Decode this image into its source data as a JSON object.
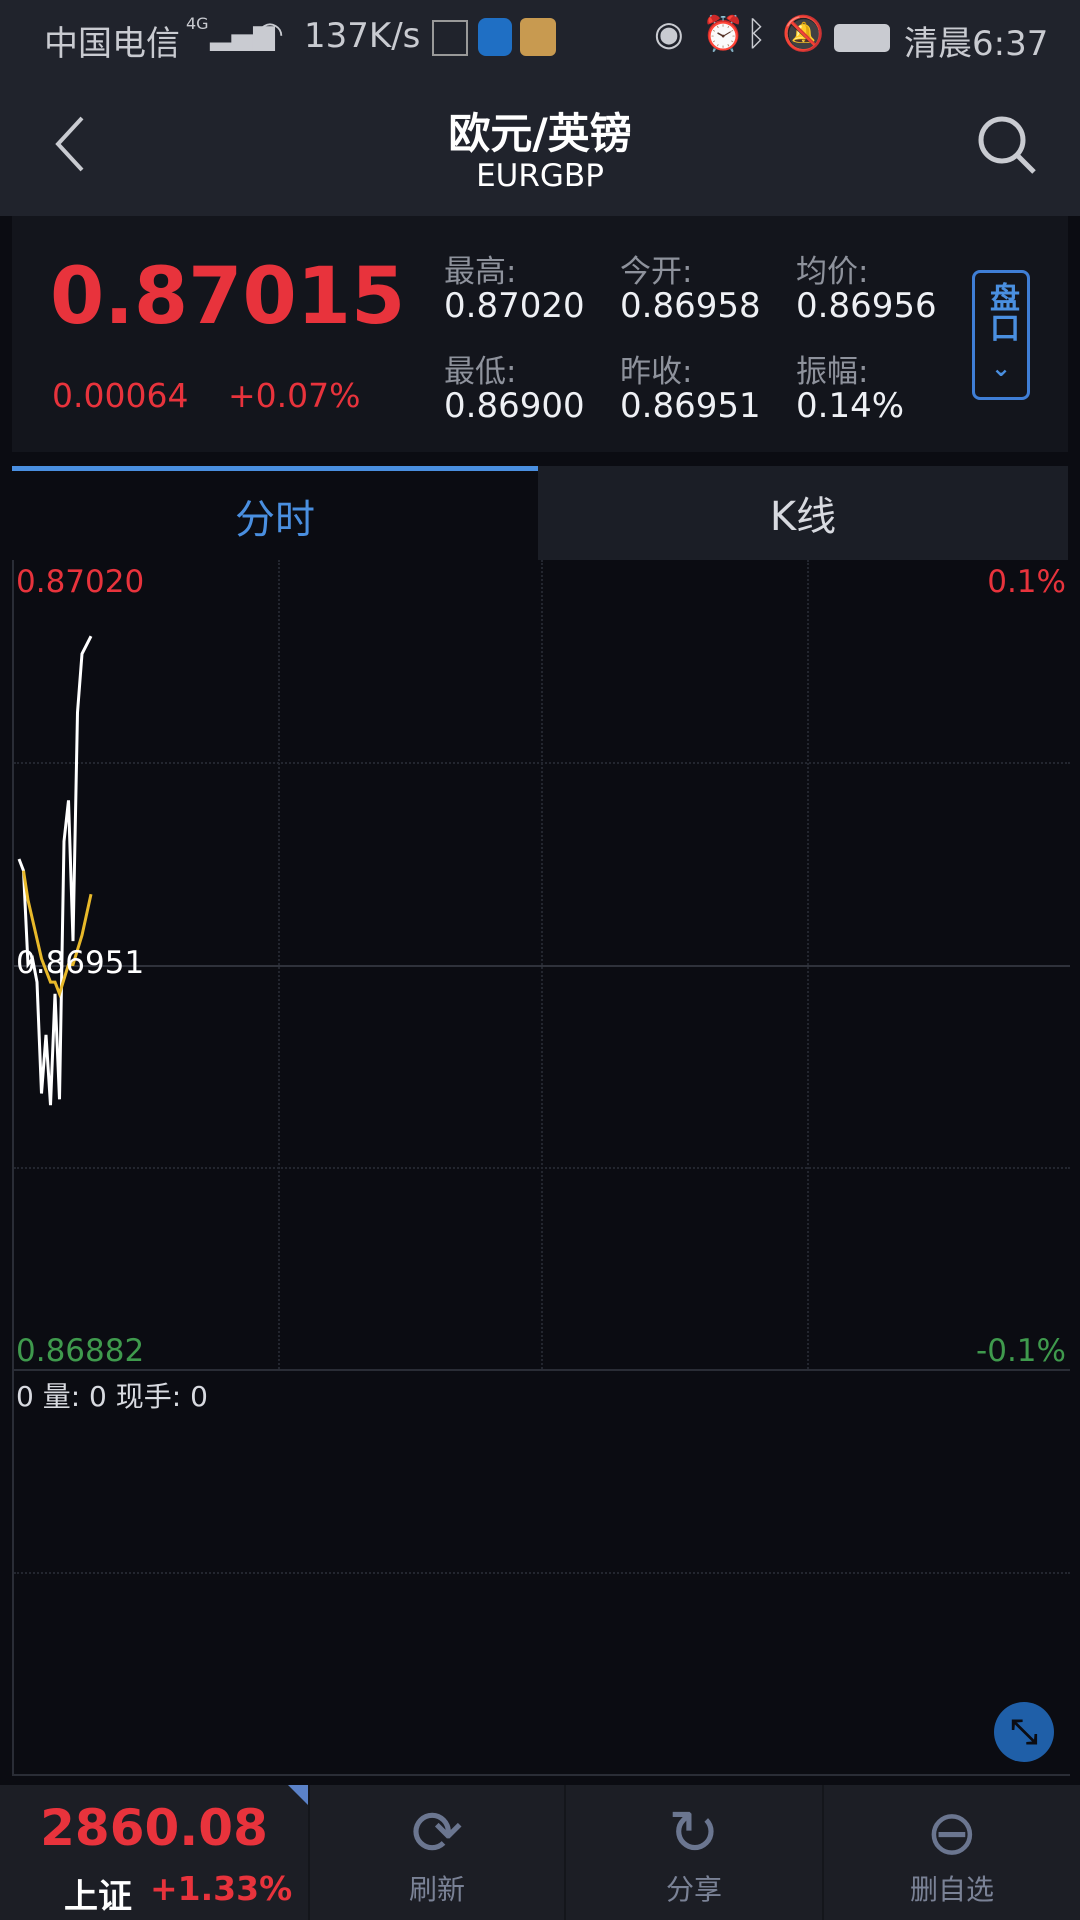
{
  "status_bar": {
    "carrier": "中国电信",
    "network": "4G",
    "speed": "137K/s",
    "time": "清晨6:37",
    "icons": [
      "signal-icon",
      "wifi-icon",
      "news-app-icon",
      "shield-app-icon",
      "app-icon",
      "eye-icon",
      "alarm-icon",
      "bluetooth-icon",
      "mute-icon",
      "battery-icon"
    ]
  },
  "header": {
    "title": "欧元/英镑",
    "subtitle": "EURGBP"
  },
  "quote": {
    "price": "0.87015",
    "change": "0.00064",
    "change_pct": "+0.07%",
    "stats": [
      {
        "label": "最高:",
        "value": "0.87020"
      },
      {
        "label": "今开:",
        "value": "0.86958"
      },
      {
        "label": "均价:",
        "value": "0.86956"
      },
      {
        "label": "最低:",
        "value": "0.86900"
      },
      {
        "label": "昨收:",
        "value": "0.86951"
      },
      {
        "label": "振幅:",
        "value": "0.14%"
      }
    ],
    "panel_button": "盘口"
  },
  "tabs": [
    {
      "label": "分时",
      "active": true
    },
    {
      "label": "K线",
      "active": false
    }
  ],
  "chart_data": {
    "type": "line",
    "ylim": [
      0.86882,
      0.8702
    ],
    "y_ticks": {
      "top": "0.87020",
      "mid": "0.86951",
      "bottom": "0.86882"
    },
    "pct_ticks": {
      "top": "0.1%",
      "bottom": "-0.1%"
    },
    "series": [
      {
        "values": [
          [
            0,
            0.86969
          ],
          [
            1,
            0.86967
          ],
          [
            2,
            0.86951
          ],
          [
            3,
            0.86952
          ],
          [
            4,
            0.86948
          ],
          [
            5,
            0.86929
          ],
          [
            6,
            0.86939
          ],
          [
            7,
            0.86927
          ],
          [
            8,
            0.86946
          ],
          [
            9,
            0.86928
          ],
          [
            10,
            0.86972
          ],
          [
            11,
            0.86979
          ],
          [
            12,
            0.86955
          ],
          [
            13,
            0.86994
          ],
          [
            14,
            0.87004
          ],
          [
            16,
            0.87007
          ]
        ],
        "color": "#ffffff"
      },
      {
        "values": [
          [
            1,
            0.86967
          ],
          [
            2,
            0.86962
          ],
          [
            5,
            0.86952
          ],
          [
            7,
            0.86948
          ],
          [
            8,
            0.86948
          ],
          [
            9,
            0.86946
          ],
          [
            11,
            0.86951
          ],
          [
            12,
            0.86951
          ],
          [
            14,
            0.86956
          ],
          [
            16,
            0.86963
          ]
        ],
        "color": "#e8b92a"
      }
    ]
  },
  "volume": {
    "text": "0 量: 0 现手: 0"
  },
  "colors": {
    "up": "#e8333c",
    "down": "#3f9a4d",
    "accent": "#4a8fe0"
  },
  "bottom": {
    "index_value": "2860.08",
    "index_name": "上证",
    "index_change": "+1.33%",
    "buttons": [
      {
        "label": "刷新"
      },
      {
        "label": "分享"
      },
      {
        "label": "删自选"
      }
    ]
  }
}
